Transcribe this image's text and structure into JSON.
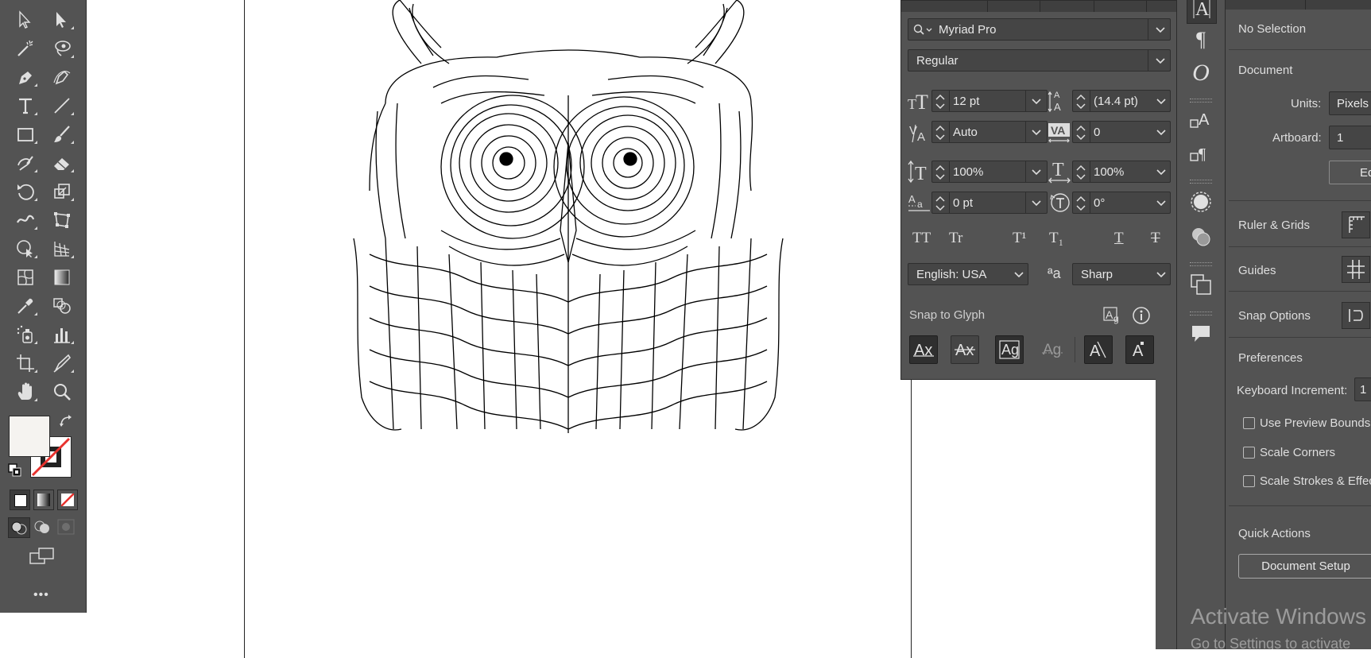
{
  "character": {
    "font_family": "Myriad Pro",
    "font_style": "Regular",
    "font_size": "12 pt",
    "leading": "(14.4 pt)",
    "kerning": "Auto",
    "tracking": "0",
    "vertical_scale": "100%",
    "horizontal_scale": "100%",
    "baseline_shift": "0 pt",
    "rotation": "0°",
    "language": "English: USA",
    "antialias_label": "ªa",
    "antialias": "Sharp",
    "snap_to_glyph": "Snap to Glyph",
    "opentype_buttons": [
      "TT",
      "Tr",
      "T¹",
      "T₁",
      "T",
      "T"
    ]
  },
  "properties": {
    "selection": "No Selection",
    "document_section": "Document",
    "units_label": "Units:",
    "units_value": "Pixels",
    "artboard_label": "Artboard:",
    "artboard_value": "1",
    "edit_button": "Ed",
    "ruler_grids": "Ruler & Grids",
    "guides": "Guides",
    "snap_options": "Snap Options",
    "preferences": "Preferences",
    "keyboard_increment_label": "Keyboard Increment:",
    "keyboard_increment_value": "1",
    "use_preview_bounds": "Use Preview Bounds",
    "scale_corners": "Scale Corners",
    "scale_strokes": "Scale Strokes & Effec",
    "quick_actions": "Quick Actions",
    "document_setup": "Document Setup"
  },
  "watermark": {
    "line1": "Activate Windows",
    "line2": "Go to Settings to activate"
  },
  "toolbar": {
    "more_label": "•••"
  },
  "colors": {
    "panel_bg": "#535353",
    "fill_swatch": "#f5f3f0",
    "none_slash": "#e8322e"
  }
}
